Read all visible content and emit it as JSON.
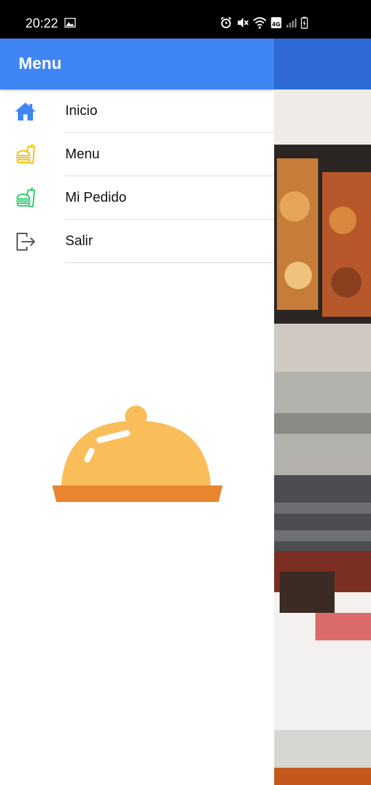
{
  "status_bar": {
    "time": "20:22",
    "network_label": "4G"
  },
  "drawer": {
    "title": "Menu",
    "items": [
      {
        "label": "Inicio",
        "icon": "home-icon",
        "color": "#3f86f4"
      },
      {
        "label": "Menu",
        "icon": "fast-food-icon",
        "color": "#f4c20d"
      },
      {
        "label": "Mi Pedido",
        "icon": "fast-food-icon",
        "color": "#2ecc71"
      },
      {
        "label": "Salir",
        "icon": "logout-icon",
        "color": "#555555"
      }
    ],
    "illustration": "food-cloche-icon"
  },
  "colors": {
    "header": "#3f86f4",
    "cloche_dome": "#f9bd5a",
    "cloche_plate": "#e8852e"
  }
}
